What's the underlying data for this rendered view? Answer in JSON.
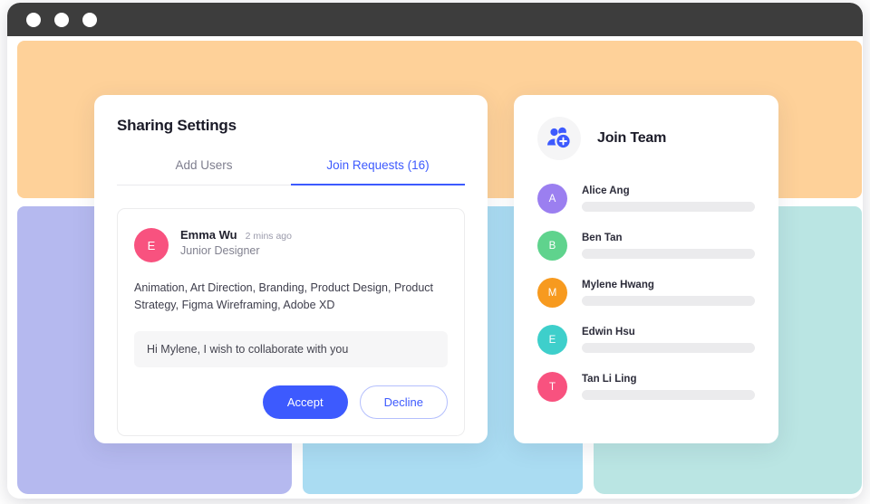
{
  "window": {
    "traffic_lights": [
      "close-dot",
      "minimize-dot",
      "maximize-dot"
    ]
  },
  "background": {
    "blocks": [
      {
        "name": "orange-band",
        "color": "#fed199"
      },
      {
        "name": "purple-block",
        "color": "#b5b9ef"
      },
      {
        "name": "blue-block",
        "color": "#aadcf2"
      },
      {
        "name": "teal-block",
        "color": "#bae5e3"
      }
    ]
  },
  "sharing_card": {
    "title": "Sharing Settings",
    "tabs": [
      {
        "label": "Add Users",
        "active": false
      },
      {
        "label": "Join Requests (16)",
        "active": true
      }
    ],
    "request": {
      "avatar_initial": "E",
      "avatar_color": "#f8527f",
      "name": "Emma Wu",
      "time": "2 mins ago",
      "role": "Junior Designer",
      "skills": "Animation, Art Direction, Branding, Product Design, Product Strategy, Figma Wireframing, Adobe XD",
      "message": "Hi Mylene, I wish to collaborate with you",
      "accept_label": "Accept",
      "decline_label": "Decline"
    }
  },
  "join_panel": {
    "title": "Join Team",
    "icon": "add-people-icon",
    "members": [
      {
        "initial": "A",
        "name": "Alice Ang",
        "color": "#9b7ff0"
      },
      {
        "initial": "B",
        "name": "Ben Tan",
        "color": "#5fd38d"
      },
      {
        "initial": "M",
        "name": "Mylene Hwang",
        "color": "#f79a1f"
      },
      {
        "initial": "E",
        "name": "Edwin Hsu",
        "color": "#3ecfcb"
      },
      {
        "initial": "T",
        "name": "Tan Li Ling",
        "color": "#f8527f"
      }
    ]
  },
  "colors": {
    "accent_blue": "#3d5afe",
    "skeleton_gray": "#ebebed",
    "titlebar": "#3d3d3d"
  }
}
